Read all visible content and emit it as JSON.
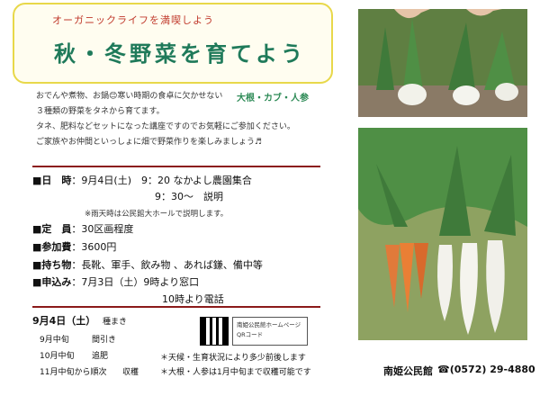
{
  "header": {
    "subtitle": "オーガニックライフを満喫しよう",
    "title": "秋・冬野菜を育てよう"
  },
  "intro": {
    "line1": "おでんや煮物、お鍋😊寒い時期の食卓に欠かせない",
    "highlight": "大根・カブ・人参",
    "line2": "３種類の野菜をタネから育てます。",
    "line3": "タネ、肥料などセットになった講座ですのでお気軽にご参加ください。",
    "line4": "ご家族やお仲間といっしょに畑で野菜作りを楽しみましょう♬"
  },
  "info": {
    "date_label": "■日　時",
    "date_value": "：9月4日(土)　9：20 なかよし農園集合",
    "date_value2": "9：30～　説明",
    "rain_note": "※雨天時は公民館大ホールで説明します。",
    "capacity_label": "■定　員",
    "capacity_value": "：30区画程度",
    "fee_label": "■参加費",
    "fee_value": "：3600円",
    "items_label": "■持ち物",
    "items_value": "：長靴、軍手、飲み物 、あれば鎌、備中等",
    "apply_label": "■申込み",
    "apply_value": "：7月3日（土）9時より窓口",
    "apply_value2": "10時より電話"
  },
  "schedule": {
    "title": "9月4日（土）",
    "title_suffix": "種まき",
    "items": [
      {
        "when": "9月中旬",
        "what": "間引き"
      },
      {
        "when": "10月中旬",
        "what": "追肥"
      },
      {
        "when": "11月中旬から順次",
        "what": "収穫"
      }
    ],
    "notes": [
      "＊天候・生育状況により多少前後します",
      "＊大根・人参は1月中旬まで収穫可能です"
    ]
  },
  "qr": {
    "line1": "南姫公民館ホームページ",
    "line2": "QRコード"
  },
  "footer": {
    "org": "南姫公民館",
    "tel": "☎(0572) 29-4880"
  }
}
